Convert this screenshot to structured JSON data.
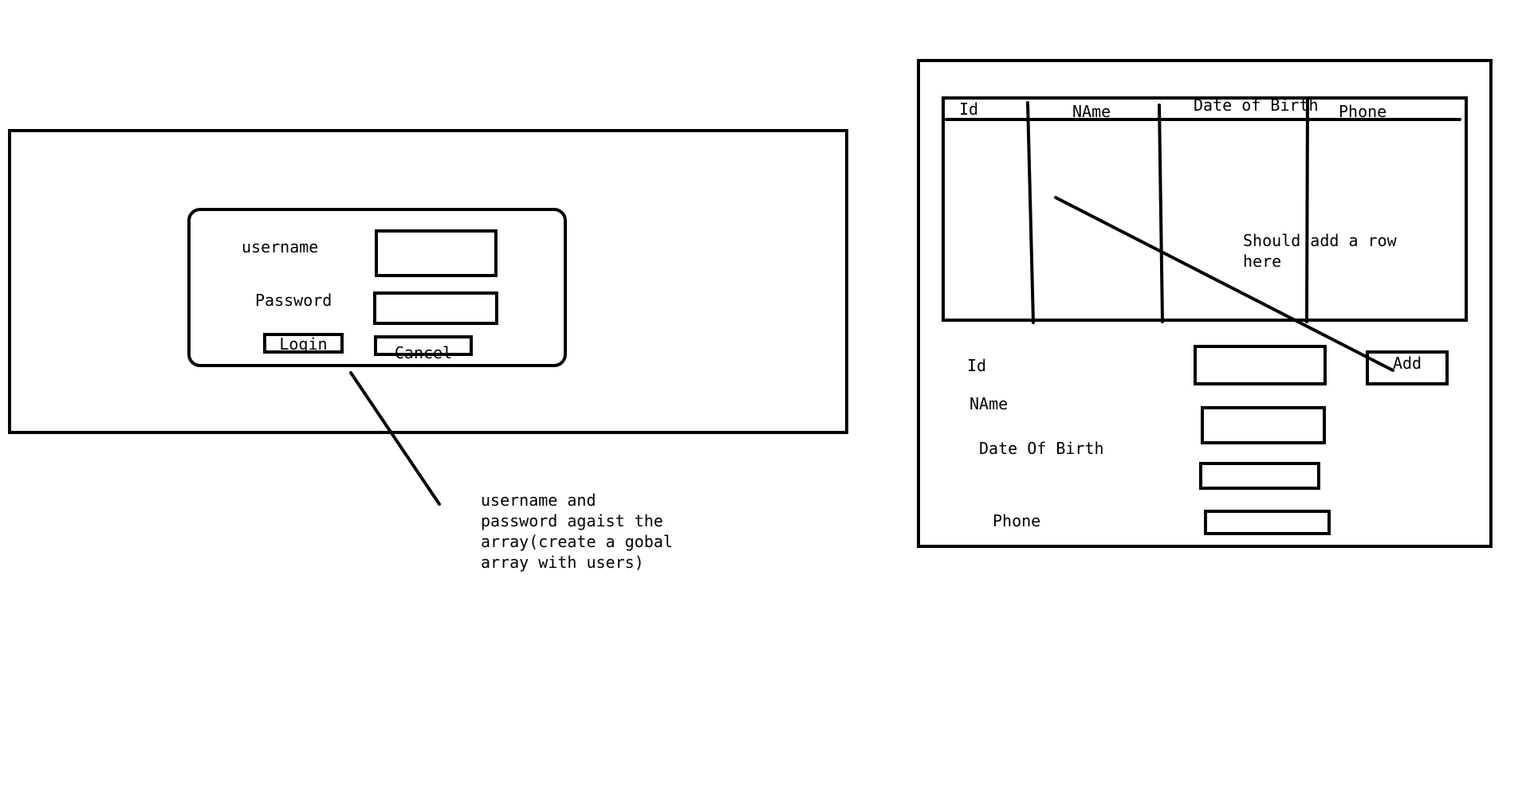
{
  "login_panel": {
    "username_label": "username",
    "password_label": "Password",
    "login_button": "Login",
    "cancel_button": "Cancel",
    "note": "username and\npassword agaist the\narray(create a gobal\narray with users)"
  },
  "user_panel": {
    "table_headers": [
      "Id",
      "NAme",
      "Date of Birth",
      "Phone"
    ],
    "table_note": "Should add a row\nhere",
    "form_labels": {
      "id": "Id",
      "name": "NAme",
      "dob": "Date Of Birth",
      "phone": "Phone"
    },
    "add_button": "Add"
  },
  "colors": {
    "stroke": "#000000",
    "background": "#ffffff"
  }
}
